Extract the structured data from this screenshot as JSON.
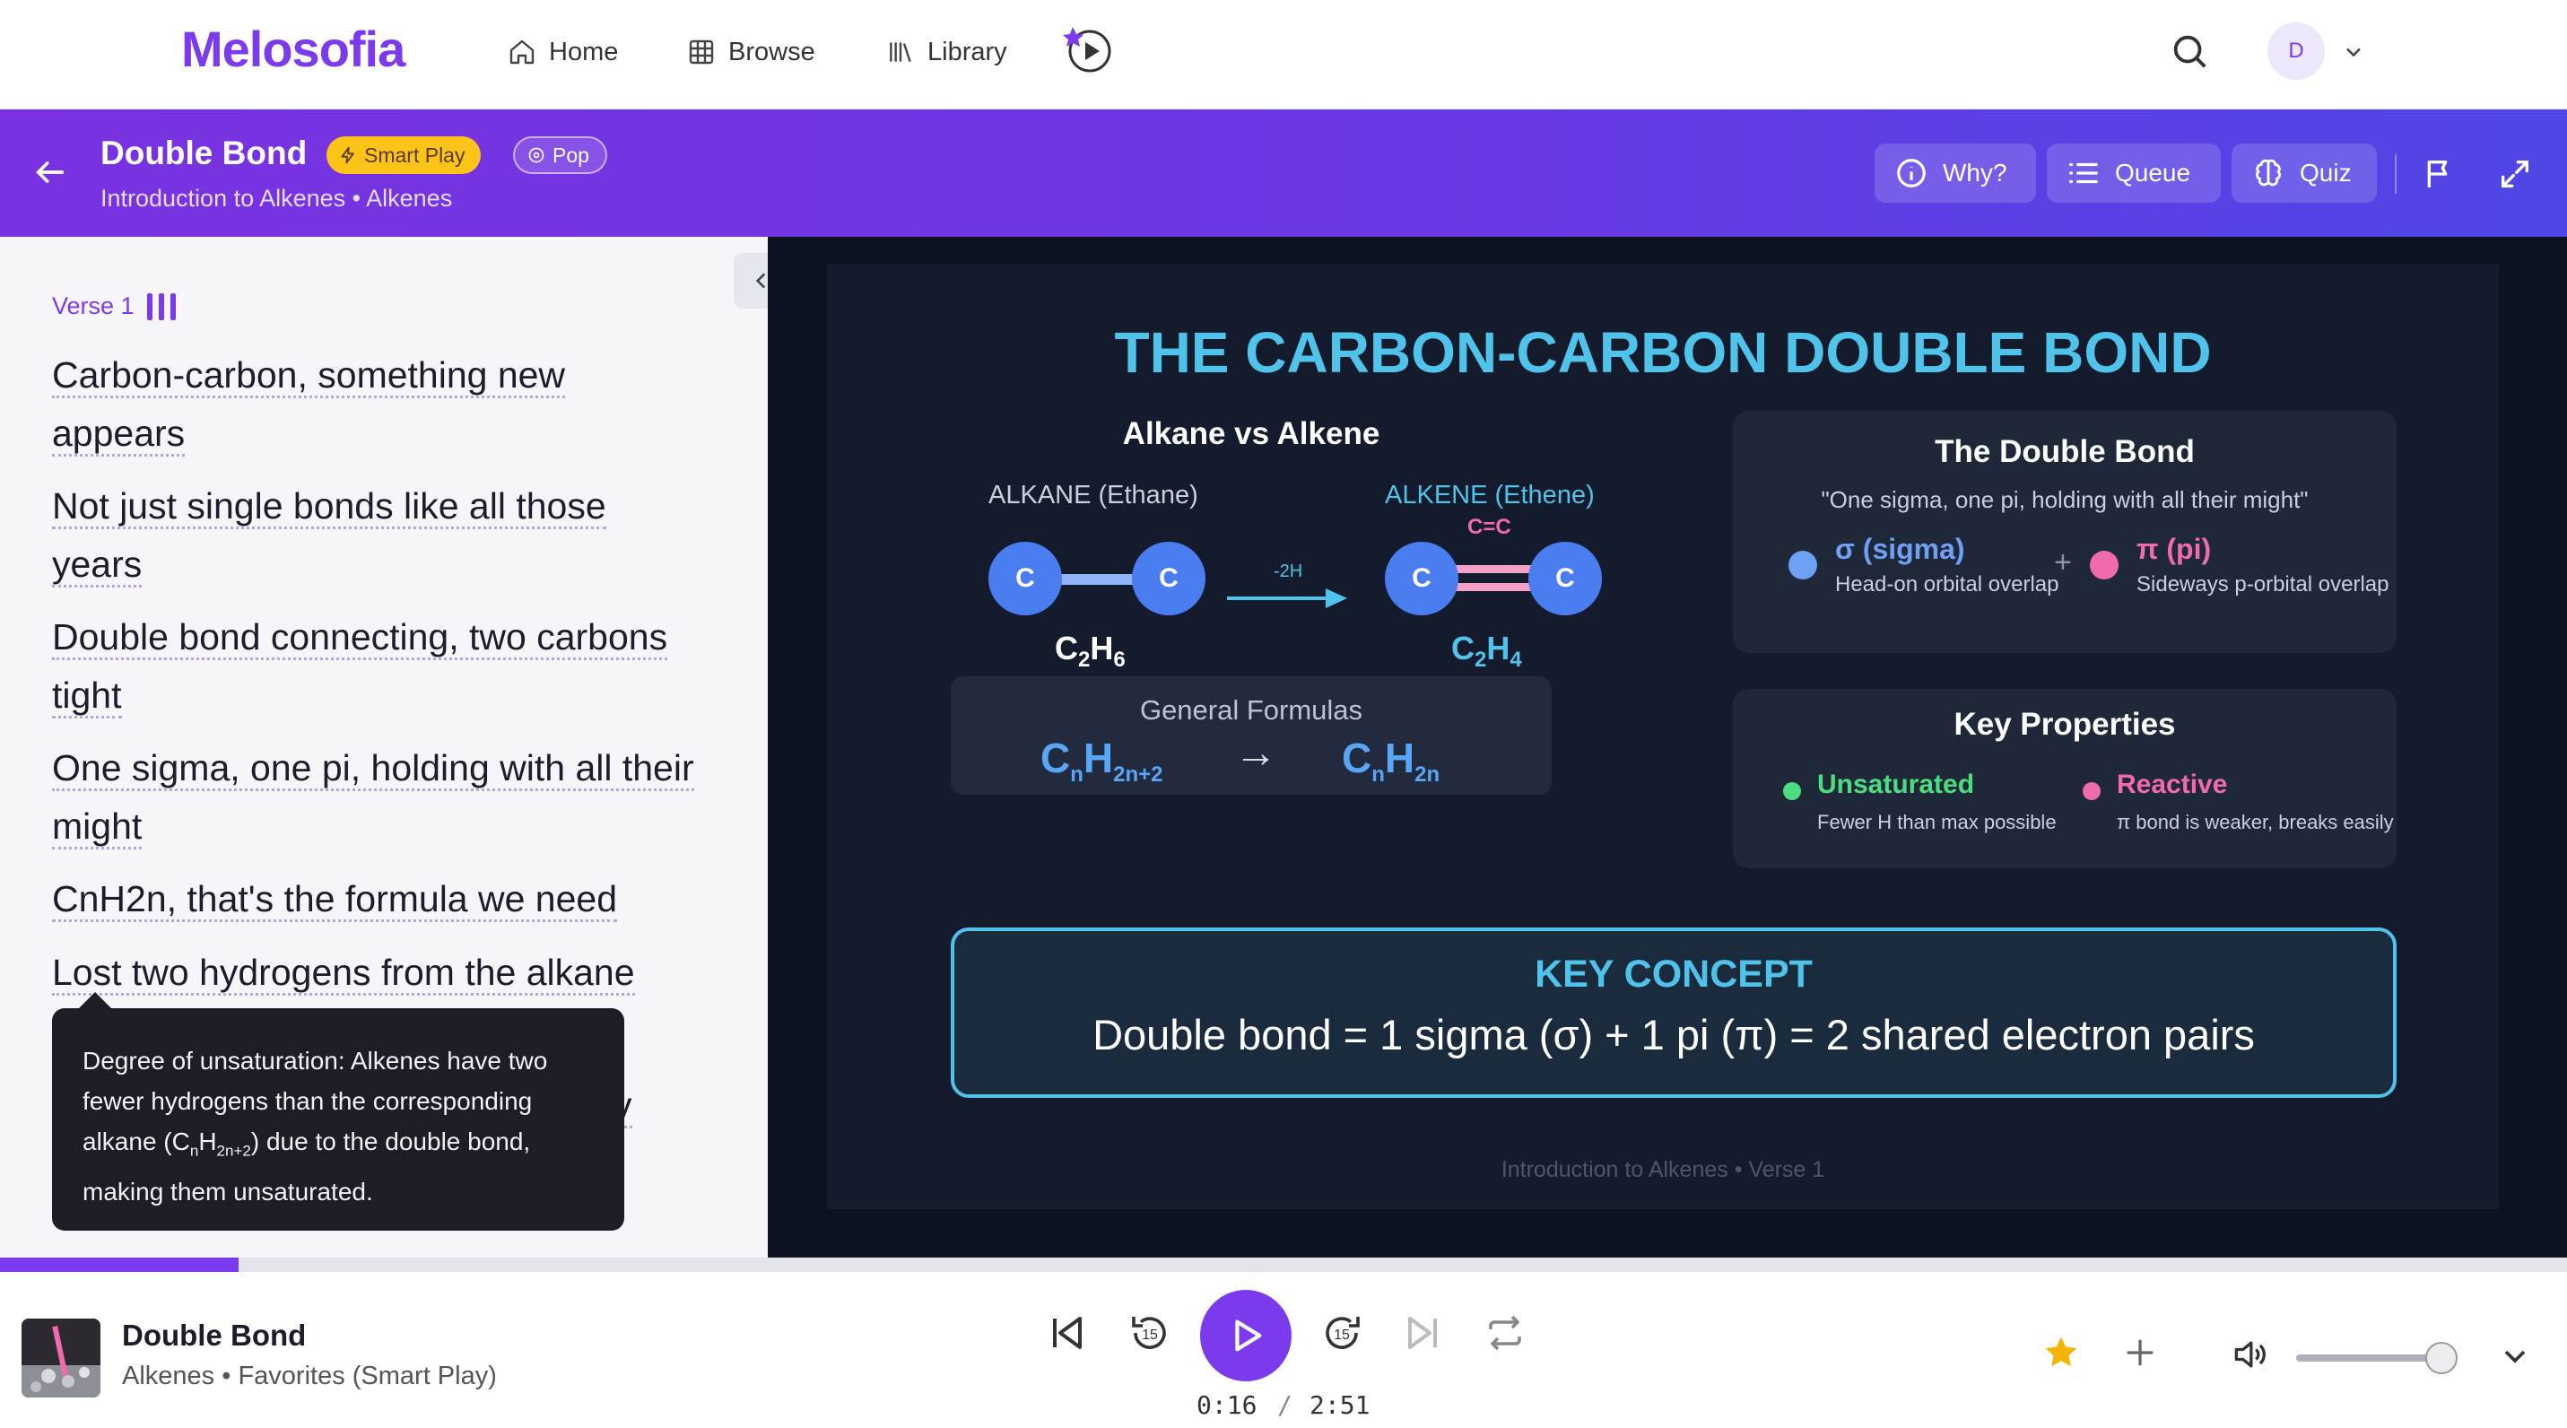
{
  "app": {
    "logo": "Melosofia"
  },
  "nav": {
    "home": "Home",
    "browse": "Browse",
    "library": "Library"
  },
  "user": {
    "initial": "D"
  },
  "header": {
    "title": "Double Bond",
    "badge_smart": "Smart Play",
    "badge_pop": "Pop",
    "subtitle": "Introduction to Alkenes • Alkenes",
    "buttons": {
      "why": "Why?",
      "queue": "Queue",
      "quiz": "Quiz"
    }
  },
  "lyrics": {
    "verse_label": "Verse 1",
    "lines": [
      "Carbon-carbon, something new appears",
      "Not just single bonds like all those years",
      "Double bond connecting, two carbons tight",
      "One sigma, one pi, holding with all their might",
      "CnH2n, that's the formula we need",
      "Lost two hydrogens from the alkane",
      "y"
    ],
    "tooltip": {
      "pre": "Degree of unsaturation: Alkenes have two fewer hydrogens than the corresponding alkane (C",
      "s1": "n",
      "mid": "H",
      "s2": "2n+2",
      "post": ") due to the double bond, making them unsaturated."
    }
  },
  "slide": {
    "title": "THE CARBON-CARBON DOUBLE BOND",
    "comparison": {
      "heading": "Alkane vs Alkene",
      "alkane_label": "ALKANE (Ethane)",
      "alkene_label": "ALKENE (Ethene)",
      "bond_label": "C=C",
      "arrow_label": "-2H",
      "atom": "C",
      "alkane_formula": {
        "c": "C",
        "cn": "2",
        "h": "H",
        "hn": "6"
      },
      "alkene_formula": {
        "c": "C",
        "cn": "2",
        "h": "H",
        "hn": "4"
      },
      "general_label": "General Formulas",
      "gen_alkane": {
        "c": "C",
        "cn": "n",
        "h": "H",
        "hn": "2n+2"
      },
      "gen_arrow": "→",
      "gen_alkene": {
        "c": "C",
        "cn": "n",
        "h": "H",
        "hn": "2n"
      }
    },
    "double_bond_card": {
      "title": "The Double Bond",
      "quote": "\"One sigma, one pi, holding with all their might\"",
      "sigma_title": "σ (sigma)",
      "sigma_desc": "Head-on orbital overlap",
      "plus": "+",
      "pi_title": "π (pi)",
      "pi_desc": "Sideways p-orbital overlap"
    },
    "properties_card": {
      "title": "Key Properties",
      "p1_title": "Unsaturated",
      "p1_desc": "Fewer H than max possible",
      "p2_title": "Reactive",
      "p2_desc": "π bond is weaker, breaks easily"
    },
    "key_concept": {
      "title": "KEY CONCEPT",
      "body": "Double bond = 1 sigma (σ) + 1 pi (π) = 2 shared electron pairs"
    },
    "footer": "Introduction to Alkenes • Verse 1"
  },
  "player": {
    "title": "Double Bond",
    "subtitle": "Alkenes • Favorites (Smart Play)",
    "elapsed": "0:16",
    "sep": "/",
    "duration": "2:51",
    "progress_fraction": 0.093,
    "volume_fraction": 0.9,
    "skip_back_seconds": "15",
    "skip_fwd_seconds": "15"
  },
  "colors": {
    "accent": "#7c3aed",
    "slide_title": "#4fc3ea",
    "sigma": "#6fa0f5",
    "pi": "#f06aae",
    "unsaturated": "#4ade80",
    "reactive": "#f06aae"
  }
}
